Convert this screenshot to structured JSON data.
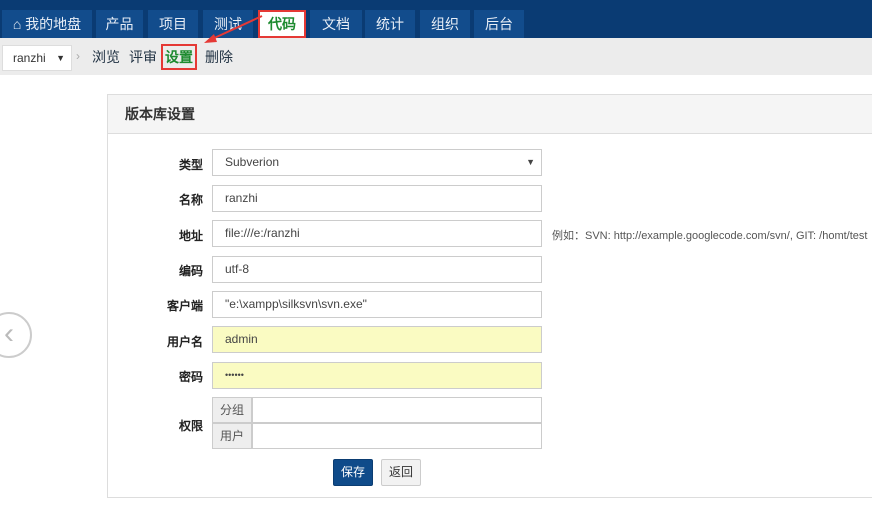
{
  "nav": {
    "tabs": [
      {
        "label": "我的地盘",
        "icon": "home-icon"
      },
      {
        "label": "产品"
      },
      {
        "label": "项目"
      },
      {
        "label": "测试"
      },
      {
        "label": "代码",
        "active": true
      },
      {
        "label": "文档"
      },
      {
        "label": "统计"
      },
      {
        "label": "组织"
      },
      {
        "label": "后台"
      }
    ]
  },
  "subnav": {
    "repo": "ranzhi",
    "items": [
      "浏览",
      "评审",
      "设置",
      "删除"
    ],
    "active": "设置"
  },
  "panel": {
    "title": "版本库设置"
  },
  "form": {
    "type_label": "类型",
    "type_value": "Subverion",
    "name_label": "名称",
    "name_value": "ranzhi",
    "path_label": "地址",
    "path_value": "file:///e:/ranzhi",
    "path_hint": "例如：SVN: http://example.googlecode.com/svn/, GIT: /homt/test",
    "encoding_label": "编码",
    "encoding_value": "utf-8",
    "client_label": "客户端",
    "client_value": "\"e:\\xampp\\silksvn\\svn.exe\"",
    "account_label": "用户名",
    "account_value": "admin",
    "password_label": "密码",
    "password_value": "••••••",
    "acl_label": "权限",
    "acl_group": "分组",
    "acl_user": "用户",
    "save": "保存",
    "back": "返回"
  },
  "colors": {
    "topbar": "#0a3b73",
    "tab": "#124c8c",
    "active_text": "#1d8a2f",
    "highlight": "#e53935",
    "primary": "#0f4b8a"
  }
}
